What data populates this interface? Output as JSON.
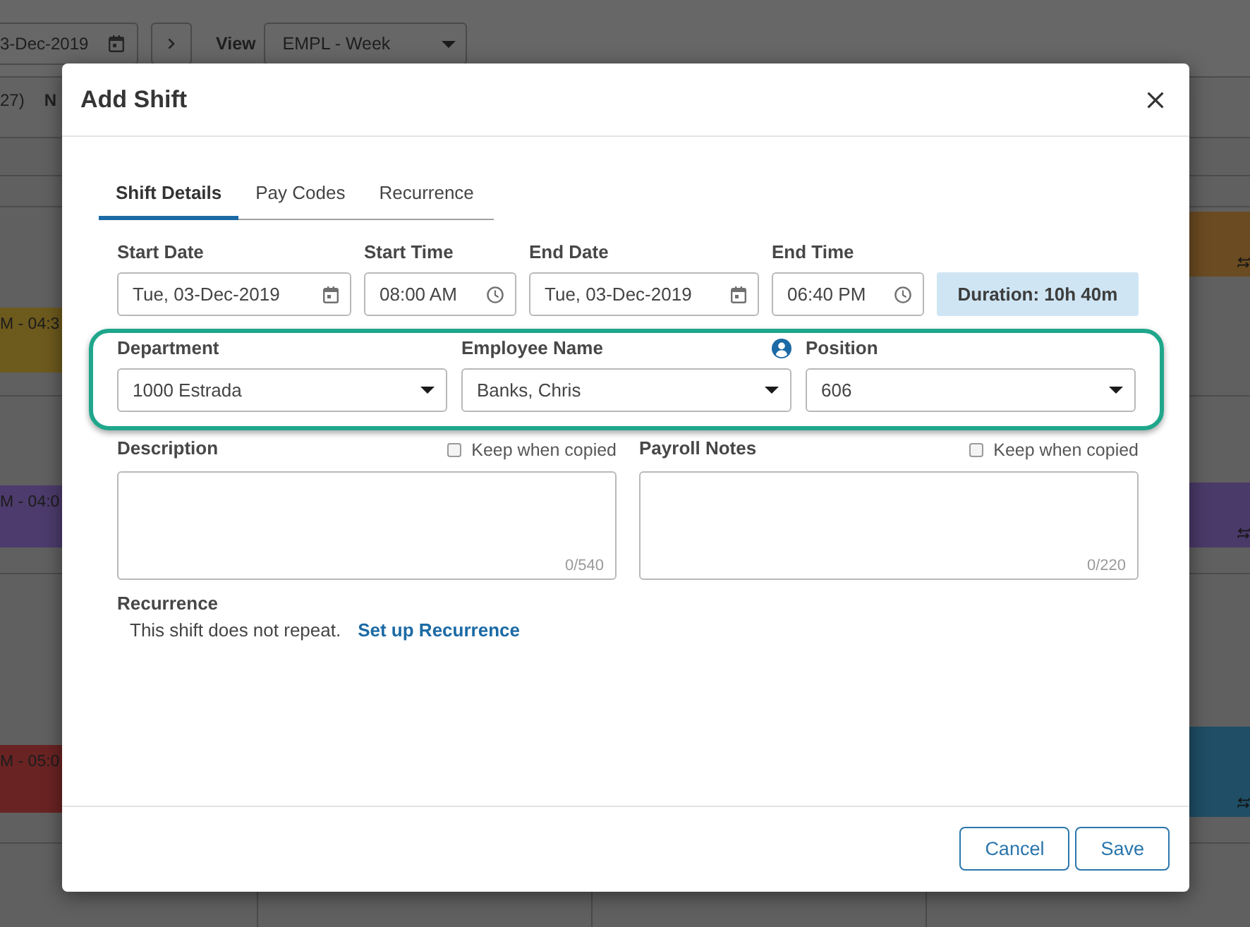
{
  "background": {
    "toolbar": {
      "date": "3-Dec-2019",
      "view_label": "View",
      "view_value": "EMPL - Week"
    },
    "header": {
      "column_1": "27)",
      "column_2": "N"
    },
    "schedule_rows": [
      {
        "left_shift": {
          "time": "M - 04:3",
          "color": "#6d5a1d"
        },
        "right_shift": {
          "color": "#6b4b22"
        }
      },
      {
        "left_shift": {
          "time": "M - 04:0",
          "color": "#4c3b6c"
        },
        "right_shift": {
          "color": "#4a3a69"
        }
      },
      {
        "left_shift": {
          "time": "M - 05:0",
          "color": "#6a2323"
        },
        "right_shift": {
          "color": "#1f4e66"
        }
      }
    ]
  },
  "dialog": {
    "title": "Add Shift",
    "tabs": [
      {
        "label": "Shift Details",
        "selected": true
      },
      {
        "label": "Pay Codes",
        "selected": false
      },
      {
        "label": "Recurrence",
        "selected": false
      }
    ],
    "time_fields": [
      {
        "label": "Start Date",
        "value": "Tue, 03-Dec-2019",
        "kind": "date"
      },
      {
        "label": "Start Time",
        "value": "08:00 AM",
        "kind": "time"
      },
      {
        "label": "End Date",
        "value": "Tue, 03-Dec-2019",
        "kind": "date"
      },
      {
        "label": "End Time",
        "value": "06:40 PM",
        "kind": "time"
      }
    ],
    "duration": "Duration: 10h 40m",
    "assignment": {
      "highlighted": true,
      "selects": [
        {
          "label": "Department",
          "value": "1000 Estrada",
          "kind": "plain"
        },
        {
          "label": "Employee Name",
          "value": "Banks, Chris",
          "kind": "person"
        },
        {
          "label": "Position",
          "value": "606",
          "kind": "plain"
        }
      ]
    },
    "notes": [
      {
        "label": "Description",
        "keep_label": "Keep when copied",
        "keep_checked": false,
        "counter": "0/540"
      },
      {
        "label": "Payroll Notes",
        "keep_label": "Keep when copied",
        "keep_checked": false,
        "counter": "0/220"
      }
    ],
    "recurrence": {
      "label": "Recurrence",
      "text": "This shift does not repeat.",
      "link": "Set up Recurrence"
    },
    "buttons": [
      {
        "label": "Cancel"
      },
      {
        "label": "Save"
      }
    ]
  }
}
